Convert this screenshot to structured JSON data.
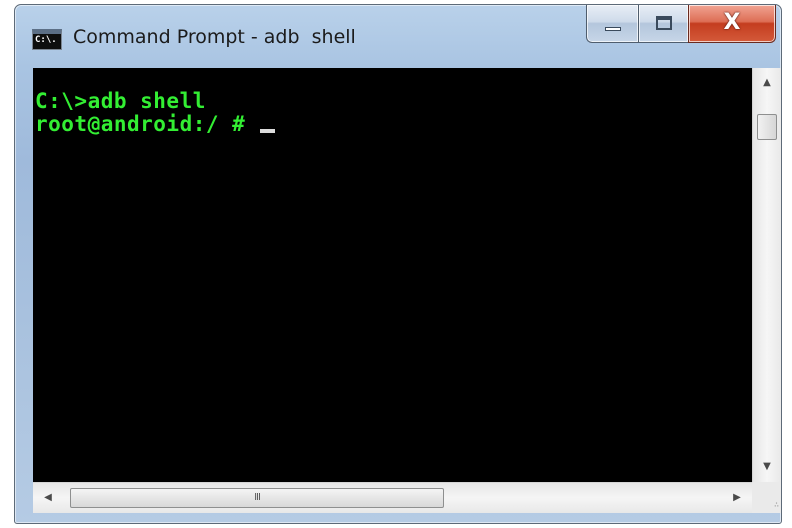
{
  "window": {
    "title": "Command Prompt - adb  shell",
    "icon": "cmd-console-icon",
    "icon_text": "C:\\."
  },
  "caption_buttons": {
    "minimize": "minimize-icon",
    "maximize": "maximize-icon",
    "close": "close-icon",
    "close_glyph": "X"
  },
  "console": {
    "lines": [
      "C:\\>adb shell",
      "root@android:/ # "
    ],
    "text_color": "#33ee33",
    "background": "#000000"
  },
  "scrollbars": {
    "up_arrow": "▲",
    "down_arrow": "▼",
    "left_arrow": "◀",
    "right_arrow": "▶",
    "h_thumb_grip": "III",
    "size_grip": "∴"
  }
}
